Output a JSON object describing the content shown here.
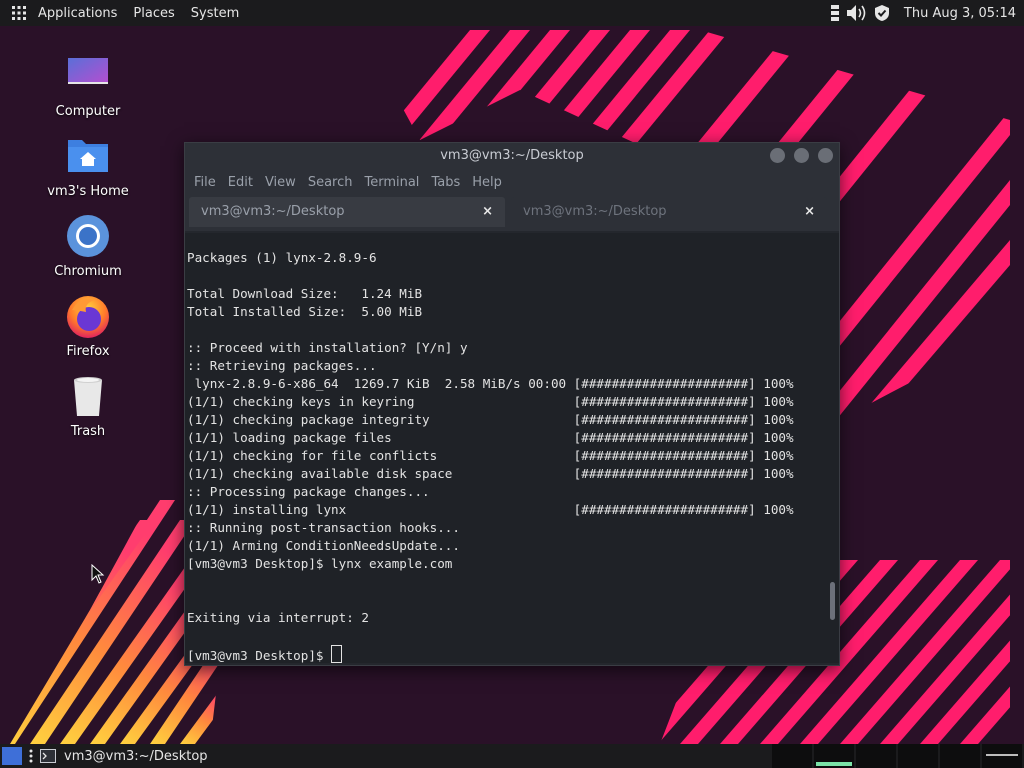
{
  "colors": {
    "panel_bg": "#1b1b1d",
    "terminal_bg": "#1f2227",
    "wallpaper_pink": "#ff1d6c",
    "wallpaper_orange": "#ff8a3d",
    "workspace_indicator": "#7be3a8",
    "show_desktop_blue": "#3e6fd8"
  },
  "top_panel": {
    "menu": [
      "Applications",
      "Places",
      "System"
    ],
    "clock": "Thu Aug  3, 05:14",
    "tray_icons": [
      "network-icon",
      "volume-icon",
      "shield-icon"
    ]
  },
  "desktop_icons": [
    {
      "label": "Computer",
      "icon": "computer-icon"
    },
    {
      "label": "vm3's Home",
      "icon": "home-folder-icon"
    },
    {
      "label": "Chromium",
      "icon": "chromium-icon"
    },
    {
      "label": "Firefox",
      "icon": "firefox-icon"
    },
    {
      "label": "Trash",
      "icon": "trash-icon"
    }
  ],
  "terminal": {
    "title": "vm3@vm3:~/Desktop",
    "menu": [
      "File",
      "Edit",
      "View",
      "Search",
      "Terminal",
      "Tabs",
      "Help"
    ],
    "tabs": [
      {
        "label": "vm3@vm3:~/Desktop",
        "close": "×",
        "active": true
      },
      {
        "label": "vm3@vm3:~/Desktop",
        "close": "×",
        "active": false
      }
    ],
    "lines": [
      "Packages (1) lynx-2.8.9-6",
      "",
      "Total Download Size:   1.24 MiB",
      "Total Installed Size:  5.00 MiB",
      "",
      ":: Proceed with installation? [Y/n] y",
      ":: Retrieving packages...",
      " lynx-2.8.9-6-x86_64  1269.7 KiB  2.58 MiB/s 00:00 [######################] 100%",
      "(1/1) checking keys in keyring                     [######################] 100%",
      "(1/1) checking package integrity                   [######################] 100%",
      "(1/1) loading package files                        [######################] 100%",
      "(1/1) checking for file conflicts                  [######################] 100%",
      "(1/1) checking available disk space                [######################] 100%",
      ":: Processing package changes...",
      "(1/1) installing lynx                              [######################] 100%",
      ":: Running post-transaction hooks...",
      "(1/1) Arming ConditionNeedsUpdate...",
      "[vm3@vm3 Desktop]$ lynx example.com",
      "",
      "",
      "Exiting via interrupt: 2",
      "",
      "[vm3@vm3 Desktop]$ "
    ],
    "scroll_position": 0.9
  },
  "bottom_panel": {
    "task_label": "vm3@vm3:~/Desktop",
    "workspace_count": 6,
    "active_workspace": 2
  }
}
